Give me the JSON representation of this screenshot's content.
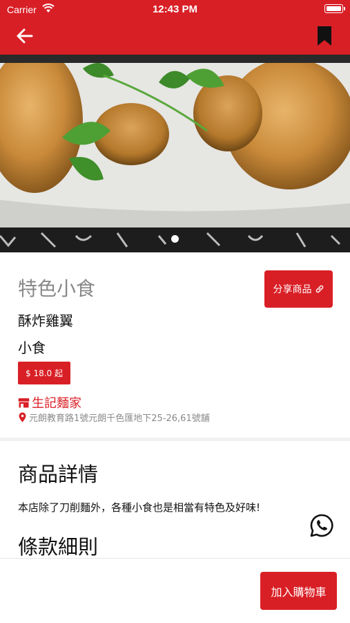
{
  "status_bar": {
    "carrier": "Carrier",
    "time": "12:43 PM"
  },
  "header": {
    "back_icon": "arrow-left-icon",
    "bookmark_icon": "bookmark-icon",
    "color": "#d91f26"
  },
  "gallery": {
    "image_subject": "fried-chicken-wings-photo",
    "pages": 1,
    "current_page": 1
  },
  "product": {
    "category_title": "特色小食",
    "name": "酥炸雞翼",
    "category": "小食",
    "price": "$ 18.0 起",
    "share_label": "分享商品"
  },
  "shop": {
    "name": "生記麵家",
    "address": "元朗教育路1號元朗千色匯地下25-26,61號舖"
  },
  "details": {
    "heading": "商品詳情",
    "text": "本店除了刀削麵外，各種小食也是相當有特色及好味!",
    "terms_heading": "條款細則"
  },
  "footer": {
    "add_to_cart_label": "加入購物車"
  }
}
